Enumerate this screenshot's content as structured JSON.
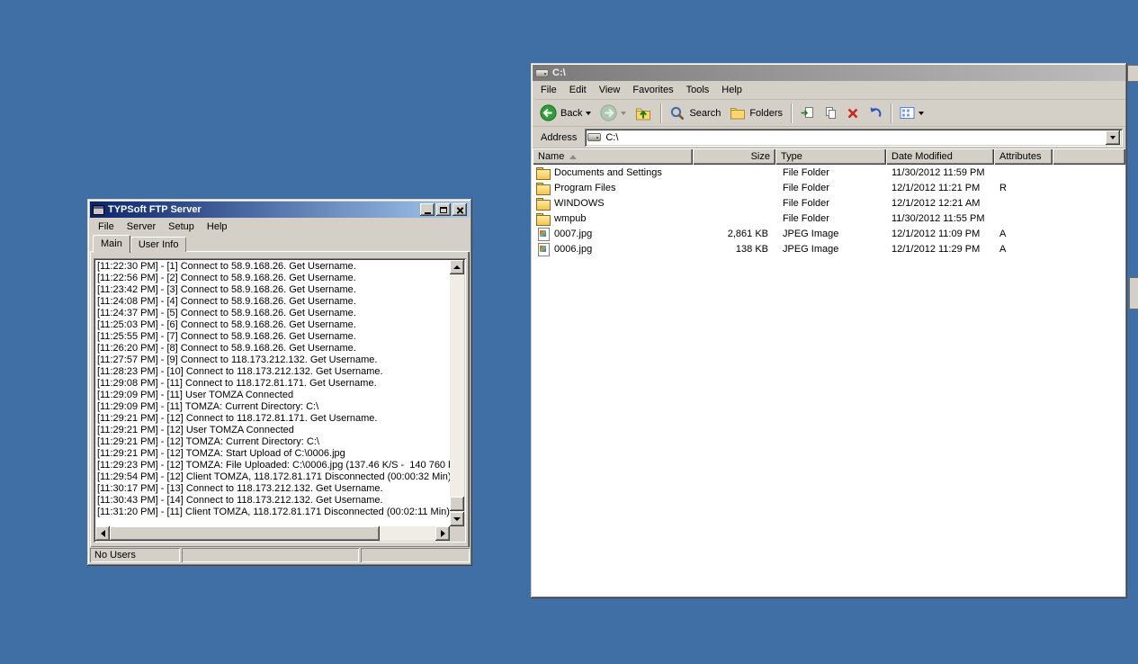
{
  "colors": {
    "desktop": "#3F6FA5",
    "chrome": "#D4D0C8",
    "title_active_start": "#0A246A",
    "title_active_end": "#A6CAF0",
    "delete_red": "#C82A1E",
    "back_green": "#2F9E39"
  },
  "ftp_window": {
    "title": "TYPSoft FTP Server",
    "menu": [
      "File",
      "Server",
      "Setup",
      "Help"
    ],
    "tabs": [
      "Main",
      "User Info"
    ],
    "log_lines": [
      "[11:22:30 PM] - [1] Connect to 58.9.168.26. Get Username.",
      "[11:22:56 PM] - [2] Connect to 58.9.168.26. Get Username.",
      "[11:23:42 PM] - [3] Connect to 58.9.168.26. Get Username.",
      "[11:24:08 PM] - [4] Connect to 58.9.168.26. Get Username.",
      "[11:24:37 PM] - [5] Connect to 58.9.168.26. Get Username.",
      "[11:25:03 PM] - [6] Connect to 58.9.168.26. Get Username.",
      "[11:25:55 PM] - [7] Connect to 58.9.168.26. Get Username.",
      "[11:26:20 PM] - [8] Connect to 58.9.168.26. Get Username.",
      "[11:27:57 PM] - [9] Connect to 118.173.212.132. Get Username.",
      "[11:28:23 PM] - [10] Connect to 118.173.212.132. Get Username.",
      "[11:29:08 PM] - [11] Connect to 118.172.81.171. Get Username.",
      "[11:29:09 PM] - [11] User TOMZA Connected",
      "[11:29:09 PM] - [11] TOMZA: Current Directory: C:\\",
      "[11:29:21 PM] - [12] Connect to 118.172.81.171. Get Username.",
      "[11:29:21 PM] - [12] User TOMZA Connected",
      "[11:29:21 PM] - [12] TOMZA: Current Directory: C:\\",
      "[11:29:21 PM] - [12] TOMZA: Start Upload of C:\\0006.jpg",
      "[11:29:23 PM] - [12] TOMZA: File Uploaded: C:\\0006.jpg (137.46 K/S -  140 760 b",
      "[11:29:54 PM] - [12] Client TOMZA, 118.172.81.171 Disconnected (00:00:32 Min)",
      "[11:30:17 PM] - [13] Connect to 118.173.212.132. Get Username.",
      "[11:30:43 PM] - [14] Connect to 118.173.212.132. Get Username.",
      "[11:31:20 PM] - [11] Client TOMZA, 118.172.81.171 Disconnected (00:02:11 Min)"
    ],
    "status_bar": {
      "users": "No Users"
    }
  },
  "explorer_window": {
    "title": "C:\\",
    "menu": [
      "File",
      "Edit",
      "View",
      "Favorites",
      "Tools",
      "Help"
    ],
    "toolbar": {
      "back_label": "Back",
      "search_label": "Search",
      "folders_label": "Folders"
    },
    "address": {
      "label": "Address",
      "value": "C:\\"
    },
    "columns": {
      "name": "Name",
      "size": "Size",
      "type": "Type",
      "modified": "Date Modified",
      "attributes": "Attributes"
    },
    "files": [
      {
        "icon": "folder",
        "name": "Documents and Settings",
        "size": "",
        "type": "File Folder",
        "modified": "11/30/2012 11:59 PM",
        "attr": ""
      },
      {
        "icon": "folder",
        "name": "Program Files",
        "size": "",
        "type": "File Folder",
        "modified": "12/1/2012 11:21 PM",
        "attr": "R"
      },
      {
        "icon": "folder",
        "name": "WINDOWS",
        "size": "",
        "type": "File Folder",
        "modified": "12/1/2012 12:21 AM",
        "attr": ""
      },
      {
        "icon": "folder",
        "name": "wmpub",
        "size": "",
        "type": "File Folder",
        "modified": "11/30/2012 11:55 PM",
        "attr": ""
      },
      {
        "icon": "jpeg",
        "name": "0007.jpg",
        "size": "2,861 KB",
        "type": "JPEG Image",
        "modified": "12/1/2012 11:09 PM",
        "attr": "A"
      },
      {
        "icon": "jpeg",
        "name": "0006.jpg",
        "size": "138 KB",
        "type": "JPEG Image",
        "modified": "12/1/2012 11:29 PM",
        "attr": "A"
      }
    ]
  }
}
